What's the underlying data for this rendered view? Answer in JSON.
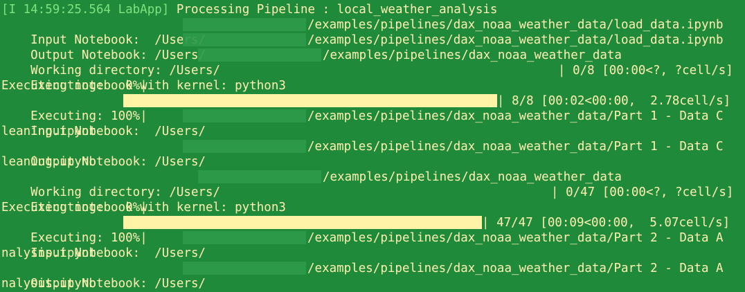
{
  "header": {
    "prefix": "[I 14:59:25.564 LabApp]",
    "message": "Processing Pipeline : local_weather_analysis"
  },
  "blocks": [
    {
      "input_label": "Input Notebook:  /Users/",
      "input_path": "/examples/pipelines/dax_noaa_weather_data/load_data.ipynb",
      "output_label": "Output Notebook: /Users/",
      "output_path": "/examples/pipelines/dax_noaa_weather_data/load_data.ipynb",
      "workdir_label": "Working directory: /Users/",
      "workdir_path": "/examples/pipelines/dax_noaa_weather_data",
      "exec0_label": "Executing:   0%|",
      "exec0_stats": "| 0/8 [00:00<?, ?cell/s]",
      "kernel_text": "Executing notebook with kernel: python3",
      "exec100_label": "Executing: 100%|",
      "exec100_stats": "| 8/8 [00:02<00:00,  2.78cell/s]",
      "progress": 1.0
    },
    {
      "input_label": "Input Notebook:  /Users/",
      "input_path": "/examples/pipelines/dax_noaa_weather_data/Part 1 - Data C",
      "input_wrap": "leaning.ipynb",
      "output_label": "Output Notebook: /Users/",
      "output_path": "/examples/pipelines/dax_noaa_weather_data/Part 1 - Data C",
      "output_wrap": "leaning.ipynb",
      "workdir_label": "Working directory: /Users/",
      "workdir_path": "/examples/pipelines/dax_noaa_weather_data",
      "exec0_label": "Executing:   0%|",
      "exec0_stats": "| 0/47 [00:00<?, ?cell/s]",
      "kernel_text": "Executing notebook with kernel: python3",
      "exec100_label": "Executing: 100%|",
      "exec100_stats": "| 47/47 [00:09<00:00,  5.07cell/s]",
      "progress": 1.0
    },
    {
      "input_label": "Input Notebook:  /Users/",
      "input_path": "/examples/pipelines/dax_noaa_weather_data/Part 2 - Data A",
      "input_wrap": "nalysis.ipynb",
      "output_label": "Output Notebook: /Users/",
      "output_path": "/examples/pipelines/dax_noaa_weather_data/Part 2 - Data A",
      "output_wrap": "nalysis.ipynb"
    }
  ],
  "colors": {
    "background": "#1f8a3a",
    "text": "#fff2b3",
    "lab_prefix": "#7ee27e",
    "progress_fill": "#fff3a6",
    "redaction": "#2e9a4b"
  }
}
